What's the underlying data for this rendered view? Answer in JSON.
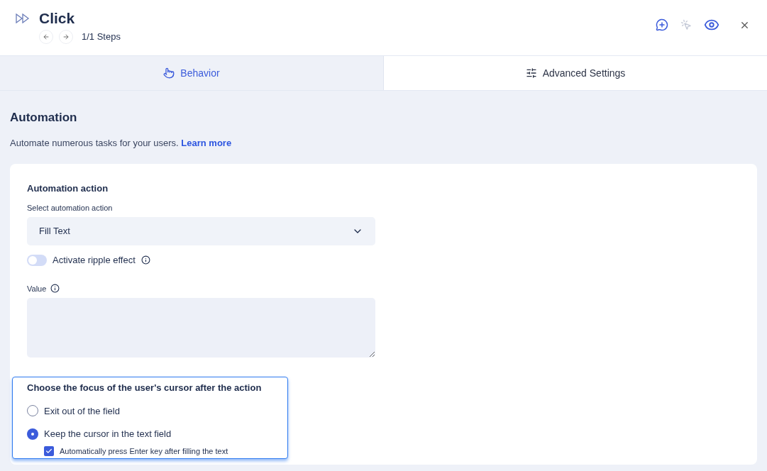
{
  "header": {
    "title": "Click",
    "steps": "1/1 Steps"
  },
  "tabs": [
    {
      "label": "Behavior",
      "selected": true
    },
    {
      "label": "Advanced Settings",
      "selected": false
    }
  ],
  "section": {
    "title": "Automation",
    "description": "Automate numerous tasks for your users.",
    "link": "Learn more"
  },
  "card": {
    "title": "Automation action",
    "select_label": "Select automation action",
    "select_value": "Fill Text",
    "ripple": {
      "label": "Activate ripple effect",
      "on": false
    },
    "value_label": "Value",
    "focus": {
      "title": "Choose the focus of the user's cursor after the action",
      "options": [
        {
          "label": "Exit out of the field",
          "selected": false
        },
        {
          "label": "Keep the cursor in the text field",
          "selected": true
        }
      ],
      "enter": {
        "label": "Automatically press Enter key after filling the text",
        "checked": true
      }
    }
  }
}
